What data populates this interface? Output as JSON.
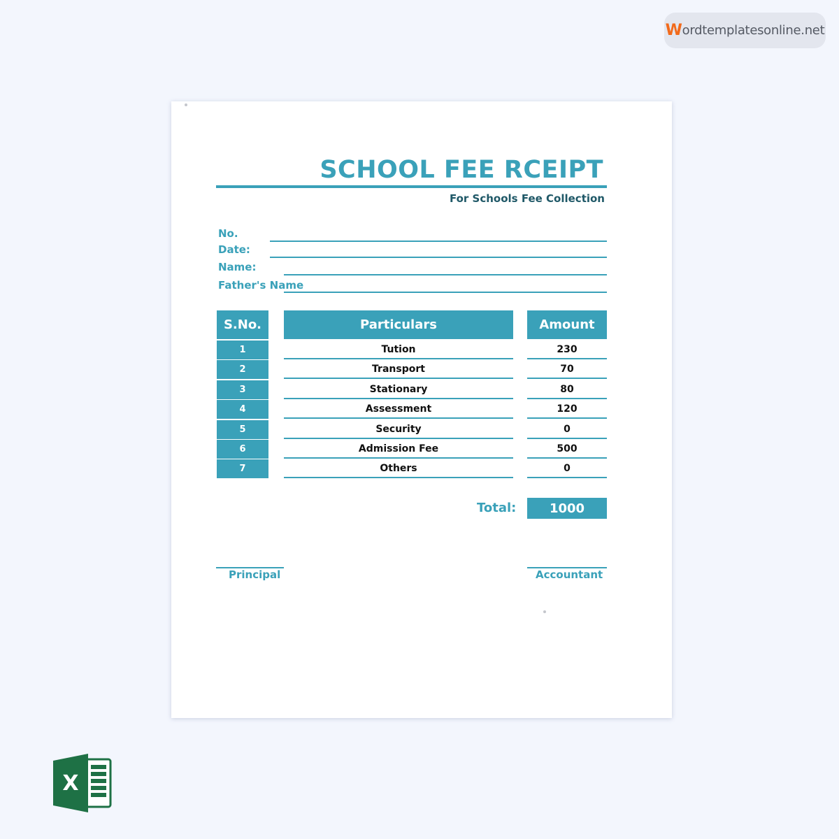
{
  "brand": {
    "initial": "W",
    "rest": "ordtemplatesonline.net"
  },
  "receipt": {
    "title": "SCHOOL FEE RCEIPT",
    "subtitle": "For Schools Fee Collection",
    "fields": [
      {
        "label": "No.",
        "value": ""
      },
      {
        "label": "Date:",
        "value": ""
      },
      {
        "label": "Name:",
        "value": ""
      },
      {
        "label": "Father's Name",
        "value": ""
      }
    ],
    "table": {
      "headers": [
        "S.No.",
        "Particulars",
        "Amount"
      ],
      "rows": [
        {
          "sno": "1",
          "particular": "Tution",
          "amount": "230"
        },
        {
          "sno": "2",
          "particular": "Transport",
          "amount": "70"
        },
        {
          "sno": "3",
          "particular": "Stationary",
          "amount": "80"
        },
        {
          "sno": "4",
          "particular": "Assessment",
          "amount": "120"
        },
        {
          "sno": "5",
          "particular": "Security",
          "amount": "0"
        },
        {
          "sno": "6",
          "particular": "Admission Fee",
          "amount": "500"
        },
        {
          "sno": "7",
          "particular": "Others",
          "amount": "0"
        }
      ]
    },
    "total_label": "Total:",
    "total_value": "1000",
    "signatures": [
      "Principal",
      "Accountant"
    ]
  },
  "file_type_icon": "excel-icon",
  "colors": {
    "accent": "#3aa1b9",
    "subtitle": "#1f5867",
    "brand_orange": "#f26a1b",
    "excel_green": "#1e7145"
  }
}
